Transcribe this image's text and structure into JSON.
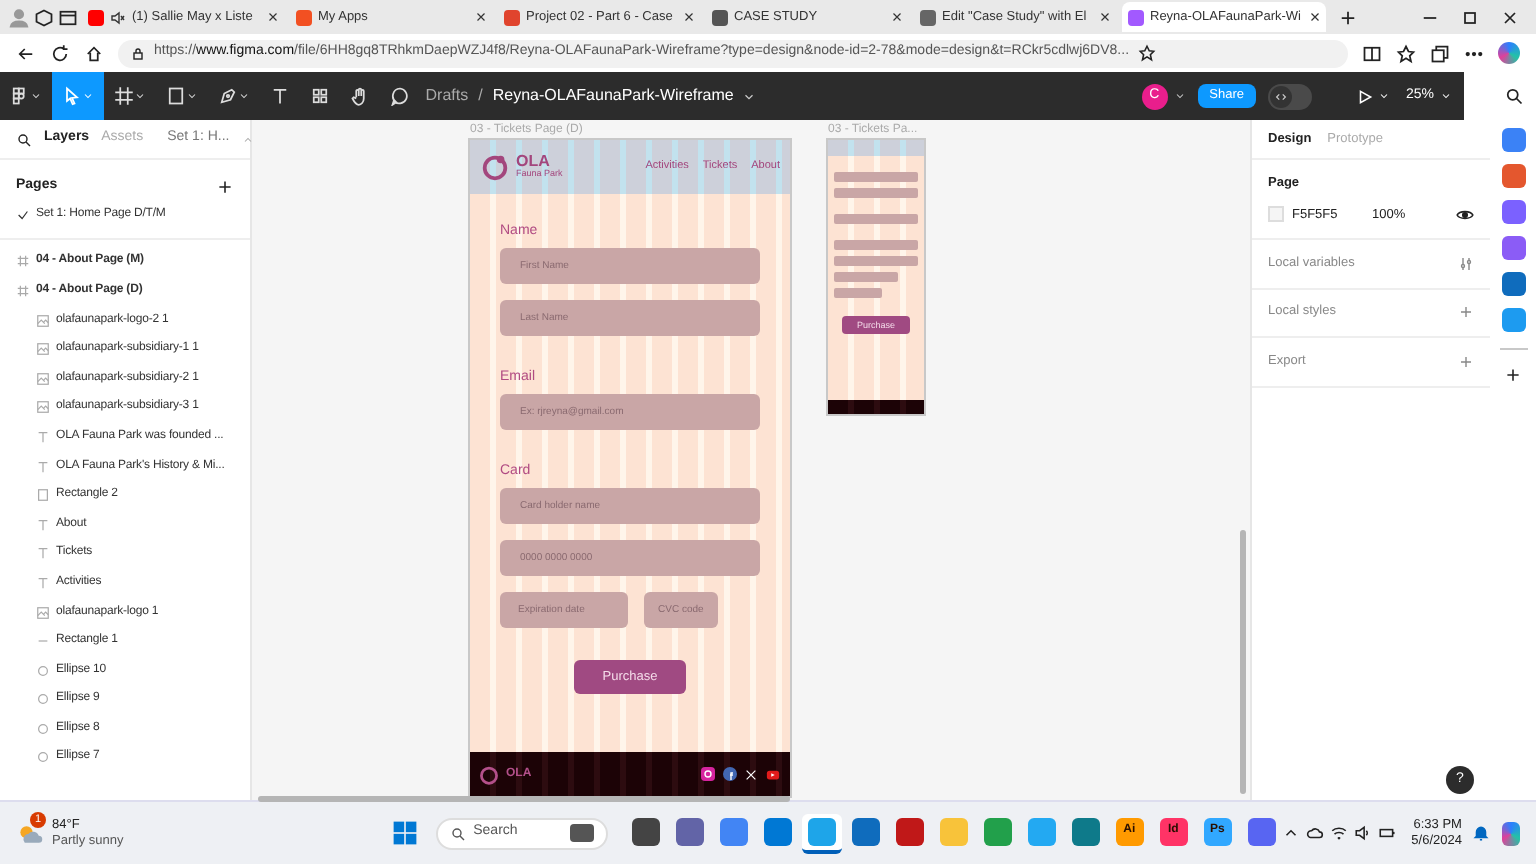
{
  "browser": {
    "tabs": [
      {
        "title": "(1) Sallie May x Liste",
        "color": "#ff0000",
        "playing_audio": true,
        "selected": false
      },
      {
        "title": "My Apps",
        "color": "#f25022",
        "playing_audio": false,
        "selected": false
      },
      {
        "title": "Project 02 - Part 6 - Case",
        "color": "#e0442d",
        "playing_audio": false,
        "selected": false
      },
      {
        "title": "CASE STUDY",
        "color": "#555555",
        "playing_audio": false,
        "selected": false
      },
      {
        "title": "Edit \"Case Study\" with El",
        "color": "#666666",
        "playing_audio": false,
        "selected": false
      },
      {
        "title": "Reyna-OLAFaunaPark-Wi",
        "color": "#a259ff",
        "playing_audio": false,
        "selected": true
      }
    ],
    "url": "https://**www.figma.com**/file/6HH8gq8TRhkmDaepWZJ4f8/Reyna-OLAFaunaPark-Wireframe?type=design&node-id=2-78&mode=design&t=RCkr5cdlwj6DV8..."
  },
  "figma": {
    "tools": [
      {
        "kind": "move",
        "selected": true
      },
      {
        "kind": "frame",
        "selected": false
      },
      {
        "kind": "shape",
        "selected": false
      },
      {
        "kind": "pen",
        "selected": false
      },
      {
        "kind": "text",
        "selected": false
      },
      {
        "kind": "resources",
        "selected": false
      },
      {
        "kind": "hand",
        "selected": false
      },
      {
        "kind": "comment",
        "selected": false
      }
    ],
    "breadcrumb": "Drafts",
    "breadcrumb_separator": "/",
    "dev_mode": false,
    "file_name": "Reyna-OLAFaunaPark-Wireframe",
    "avatar": "C",
    "share": "Share",
    "zoom": "25%"
  },
  "left_panel": {
    "tabs": [
      {
        "label": "Layers",
        "selected": true
      },
      {
        "label": "Assets",
        "selected": false
      }
    ],
    "page_selector": "Set 1: H...",
    "pages_title": "Pages",
    "pages": [
      {
        "name": "Set 1: Home Page D/T/M",
        "selected": true
      }
    ],
    "layers": [
      {
        "name": "04 - About Page (M)",
        "kind": "frame"
      },
      {
        "name": "04 - About Page (D)",
        "kind": "frame",
        "children": [
          {
            "name": "olafaunapark-logo-2 1",
            "kind": "image"
          },
          {
            "name": "olafaunapark-subsidiary-1 1",
            "kind": "image"
          },
          {
            "name": "olafaunapark-subsidiary-2 1",
            "kind": "image"
          },
          {
            "name": "olafaunapark-subsidiary-3 1",
            "kind": "image"
          },
          {
            "name": "OLA Fauna Park was founded ...",
            "kind": "text"
          },
          {
            "name": "OLA Fauna Park's History & Mi...",
            "kind": "text"
          },
          {
            "name": "Rectangle 2",
            "kind": "rectangle"
          },
          {
            "name": "About",
            "kind": "text"
          },
          {
            "name": "Tickets",
            "kind": "text"
          },
          {
            "name": "Activities",
            "kind": "text"
          },
          {
            "name": "olafaunapark-logo 1",
            "kind": "image"
          },
          {
            "name": "Rectangle 1",
            "kind": "line"
          },
          {
            "name": "Ellipse 10",
            "kind": "ellipse"
          },
          {
            "name": "Ellipse 9",
            "kind": "ellipse"
          },
          {
            "name": "Ellipse 8",
            "kind": "ellipse"
          },
          {
            "name": "Ellipse 7",
            "kind": "ellipse"
          }
        ]
      }
    ]
  },
  "canvas": {
    "frames": [
      {
        "kind": "desktop",
        "label": "03 - Tickets Page (D)",
        "logo": "OLA",
        "logo_sub": "Fauna Park",
        "nav": [
          "Activities",
          "Tickets",
          "About"
        ],
        "sections": [
          {
            "heading": "Name",
            "fields": [
              {
                "placeholder": "First Name",
                "kind": "full"
              },
              {
                "placeholder": "Last Name",
                "kind": "full"
              }
            ]
          },
          {
            "heading": "Email",
            "fields": [
              {
                "placeholder": "Ex: rjreyna@gmail.com",
                "kind": "full"
              }
            ]
          },
          {
            "heading": "Card",
            "fields": [
              {
                "placeholder": "Card holder name",
                "kind": "full"
              },
              {
                "placeholder": "0000 0000 0000",
                "kind": "full"
              },
              {
                "placeholder": "Expiration date",
                "kind": "half"
              },
              {
                "placeholder": "CVC code",
                "kind": "third"
              }
            ]
          }
        ],
        "button": "Purchase",
        "footer_logo": "OLA"
      },
      {
        "kind": "mobile",
        "label": "03 - Tickets Pa...",
        "button": "Purchase"
      }
    ],
    "help": "?"
  },
  "right_panel": {
    "tabs": [
      {
        "label": "Design",
        "selected": true
      },
      {
        "label": "Prototype",
        "selected": false
      }
    ],
    "page_title": "Page",
    "page_color": "F5F5F5",
    "opacity": "100%",
    "sections": [
      {
        "title": "Local variables",
        "kind": "variables"
      },
      {
        "title": "Local styles",
        "kind": "add"
      },
      {
        "title": "Export",
        "kind": "add"
      }
    ]
  },
  "edge_sidebar": {
    "apps": [
      {
        "color": "#3b82f6"
      },
      {
        "color": "#e4572e"
      },
      {
        "color": "#7b61ff"
      },
      {
        "color": "#8b5cf6"
      },
      {
        "color": "#0f6cbd"
      },
      {
        "color": "#1d9bf0"
      }
    ]
  },
  "taskbar": {
    "weather_badge": "1",
    "temperature": "84°F",
    "weather": "Partly sunny",
    "search": "Search",
    "apps": [
      {
        "color": "#444444",
        "active": false
      },
      {
        "color": "#6264a7",
        "active": false
      },
      {
        "color": "#4285f4",
        "active": false
      },
      {
        "color": "#0078d4",
        "active": false
      },
      {
        "color": "#1ea5e9",
        "active": true
      },
      {
        "color": "#0f6cbd",
        "active": false
      },
      {
        "color": "#c01818",
        "active": false
      },
      {
        "color": "#f8c33a",
        "active": false
      },
      {
        "color": "#22a04b",
        "active": false
      },
      {
        "color": "#23a9f2",
        "active": false
      },
      {
        "color": "#0e7a8a",
        "active": false
      },
      {
        "color": "#ff9a00",
        "label": "Ai",
        "active": false
      },
      {
        "color": "#ff3366",
        "label": "Id",
        "active": false
      },
      {
        "color": "#31a8ff",
        "label": "Ps",
        "active": false
      },
      {
        "color": "#5865f2",
        "active": false
      }
    ],
    "time": "6:33 PM",
    "date": "5/6/2024"
  }
}
